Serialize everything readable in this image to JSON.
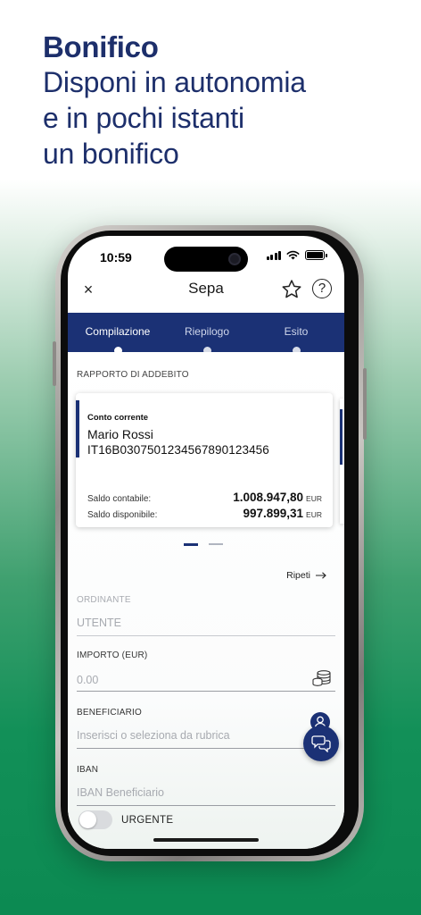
{
  "promo": {
    "title": "Bonifico",
    "subtitle_line1": "Disponi in autonomia",
    "subtitle_line2": "e in pochi istanti",
    "subtitle_line3": "un bonifico"
  },
  "status_bar": {
    "time": "10:59"
  },
  "nav": {
    "close": "×",
    "title": "Sepa",
    "help": "?"
  },
  "stepper": {
    "steps": [
      {
        "label": "Compilazione",
        "active": true
      },
      {
        "label": "Riepilogo",
        "active": false
      },
      {
        "label": "Esito",
        "active": false
      }
    ]
  },
  "account_section": {
    "label": "RAPPORTO DI ADDEBITO",
    "card": {
      "type": "Conto corrente",
      "holder": "Mario Rossi",
      "iban": "IT16B0307501234567890123456",
      "balance_label": "Saldo contabile:",
      "balance_value": "1.008.947,80",
      "available_label": "Saldo disponibile:",
      "available_value": "997.899,31",
      "currency": "EUR"
    },
    "pager_count": 2,
    "pager_active": 1
  },
  "repeat_link": "Ripeti",
  "form": {
    "ordinante": {
      "label": "ORDINANTE",
      "value": "UTENTE"
    },
    "importo": {
      "label": "IMPORTO (EUR)",
      "placeholder": "0.00"
    },
    "beneficiario": {
      "label": "BENEFICIARIO",
      "placeholder": "Inserisci o seleziona da rubrica"
    },
    "iban": {
      "label": "IBAN",
      "placeholder": "IBAN Beneficiario"
    },
    "urgente": {
      "label": "URGENTE",
      "on": false
    }
  },
  "colors": {
    "brand_navy": "#1b3175",
    "brand_green": "#0c8a52"
  },
  "icons": [
    "close-icon",
    "star-icon",
    "help-icon",
    "arrow-right-icon",
    "coins-icon",
    "contact-book-icon",
    "chat-icon"
  ]
}
